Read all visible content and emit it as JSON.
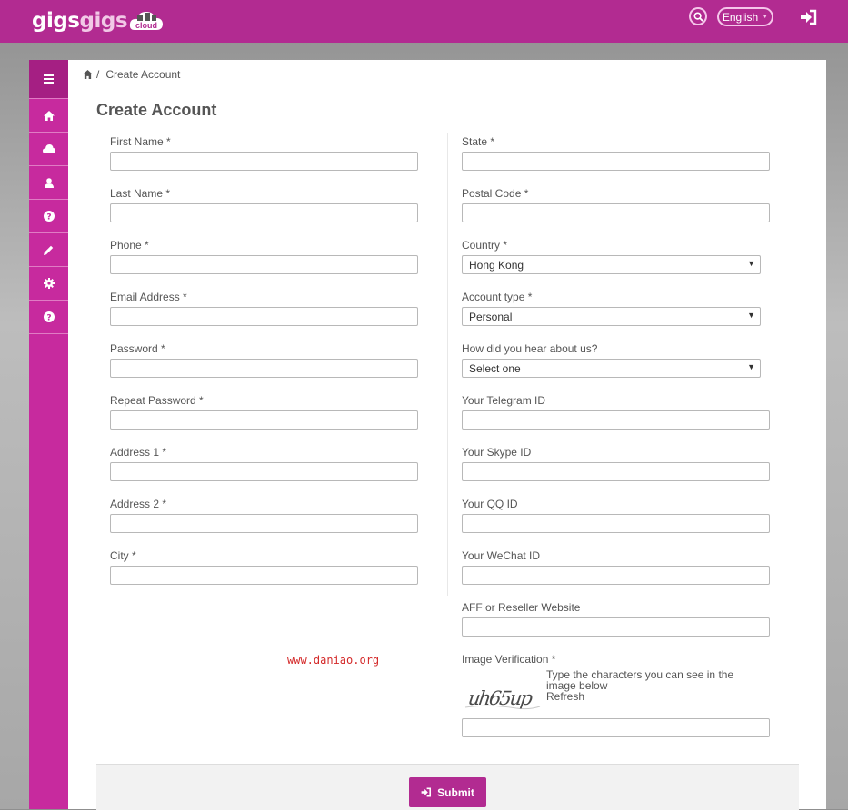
{
  "header": {
    "logo_word1": "gigs",
    "logo_word2": "gigs",
    "logo_cloud": "cloud",
    "language": "English",
    "search_icon": "search-icon",
    "login_icon": "sign-in-icon"
  },
  "sidebar": {
    "items": [
      {
        "icon": "menu-icon"
      },
      {
        "icon": "home-icon"
      },
      {
        "icon": "cloud-icon"
      },
      {
        "icon": "user-icon"
      },
      {
        "icon": "question-icon"
      },
      {
        "icon": "pencil-icon"
      },
      {
        "icon": "gear-icon"
      },
      {
        "icon": "question-icon"
      }
    ]
  },
  "breadcrumb": {
    "home_icon": "home-icon",
    "separator": "/",
    "current": "Create Account"
  },
  "page_title": "Create Account",
  "form": {
    "left": [
      {
        "label": "First Name *",
        "value": ""
      },
      {
        "label": "Last Name *",
        "value": ""
      },
      {
        "label": "Phone *",
        "value": ""
      },
      {
        "label": "Email Address *",
        "value": ""
      },
      {
        "label": "Password *",
        "value": ""
      },
      {
        "label": "Repeat Password *",
        "value": ""
      },
      {
        "label": "Address 1 *",
        "value": ""
      },
      {
        "label": "Address 2 *",
        "value": ""
      },
      {
        "label": "City *",
        "value": ""
      }
    ],
    "right": {
      "state": {
        "label": "State *",
        "value": ""
      },
      "postal_code": {
        "label": "Postal Code *",
        "value": ""
      },
      "country": {
        "label": "Country *",
        "selected": "Hong Kong"
      },
      "account_type": {
        "label": "Account type *",
        "selected": "Personal"
      },
      "heard_about": {
        "label": "How did you hear about us?",
        "selected": "Select one"
      },
      "telegram": {
        "label": "Your Telegram ID",
        "value": ""
      },
      "skype": {
        "label": "Your Skype ID",
        "value": ""
      },
      "qq": {
        "label": "Your QQ ID",
        "value": ""
      },
      "wechat": {
        "label": "Your WeChat ID",
        "value": ""
      },
      "aff_website": {
        "label": "AFF or Reseller Website",
        "value": ""
      },
      "image_verification": {
        "label": "Image Verification *",
        "captcha_text": "uh65up",
        "help_line1": "Type the characters you can see in the",
        "help_line2": "image below",
        "refresh": "Refresh",
        "value": ""
      }
    }
  },
  "watermark": "www.daniao.org",
  "submit": {
    "label": "Submit",
    "icon": "sign-in-icon"
  },
  "colors": {
    "brand": "#b22b91",
    "sidebar": "#c72a9e"
  }
}
